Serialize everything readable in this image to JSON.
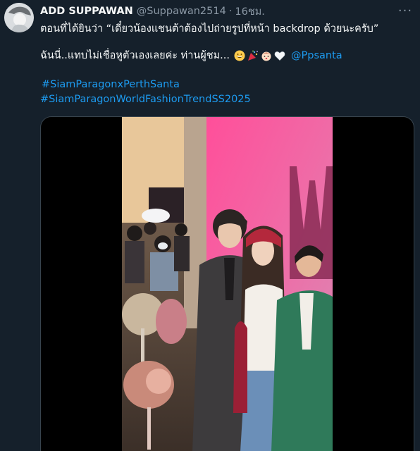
{
  "tweet": {
    "display_name": "ADD SUPPAWAN",
    "handle": "@Suppawan2514",
    "separator": "·",
    "time": "16ชม.",
    "more_label": "···",
    "line1": "ตอนที่ได้ยินว่า “เดี๋ยวน้องแชนต้าต้องไปถ่ายรูปที่หน้า backdrop ด้วยนะครับ”",
    "line2": "ฉันนี่..แทบไม่เชื่อหูตัวเองเลยค่ะ ท่านผู้ชม...",
    "emojis": [
      "grinning-face-icon",
      "party-popper-icon",
      "face-icon",
      "white-heart-icon"
    ],
    "mention": "@Ppsanta",
    "hashtags": [
      "#SiamParagonxPerthSanta",
      "#SiamParagonWorldFashionTrendSS2025"
    ]
  },
  "colors": {
    "background": "#15202b",
    "text": "#f7f9f9",
    "secondary": "#8b98a5",
    "link": "#1d9bf0",
    "border": "#38444d"
  }
}
